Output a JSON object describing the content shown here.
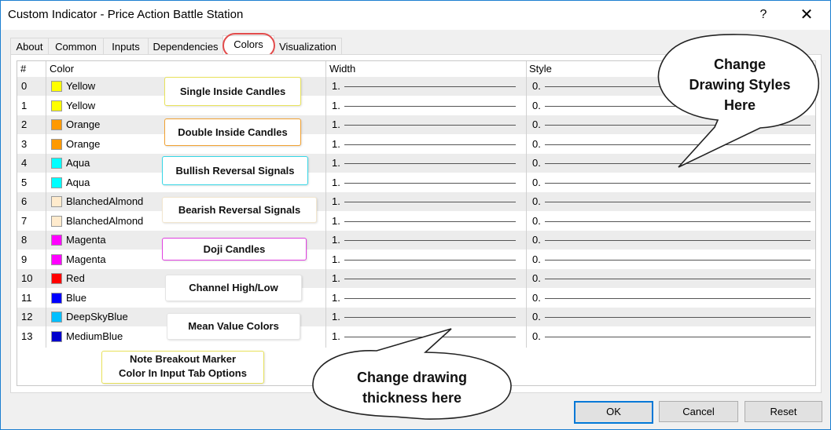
{
  "window": {
    "title": "Custom Indicator - Price Action Battle Station",
    "help_glyph": "?",
    "close_glyph": "✕"
  },
  "tabs": [
    {
      "label": "About",
      "active": false
    },
    {
      "label": "Common",
      "active": false
    },
    {
      "label": "Inputs",
      "active": false
    },
    {
      "label": "Dependencies",
      "active": false
    },
    {
      "label": "Colors",
      "active": true
    },
    {
      "label": "Visualization",
      "active": false
    }
  ],
  "table": {
    "headers": {
      "num": "#",
      "color": "Color",
      "width": "Width",
      "style": "Style"
    },
    "rows": [
      {
        "num": "0",
        "color": "Yellow",
        "hex": "#ffff00",
        "width": "1.",
        "style": "0."
      },
      {
        "num": "1",
        "color": "Yellow",
        "hex": "#ffff00",
        "width": "1.",
        "style": "0."
      },
      {
        "num": "2",
        "color": "Orange",
        "hex": "#ff9900",
        "width": "1.",
        "style": "0."
      },
      {
        "num": "3",
        "color": "Orange",
        "hex": "#ff9900",
        "width": "1.",
        "style": "0."
      },
      {
        "num": "4",
        "color": "Aqua",
        "hex": "#00ffff",
        "width": "1.",
        "style": "0."
      },
      {
        "num": "5",
        "color": "Aqua",
        "hex": "#00ffff",
        "width": "1.",
        "style": "0."
      },
      {
        "num": "6",
        "color": "BlanchedAlmond",
        "hex": "#ffebcd",
        "width": "1.",
        "style": "0."
      },
      {
        "num": "7",
        "color": "BlanchedAlmond",
        "hex": "#ffebcd",
        "width": "1.",
        "style": "0."
      },
      {
        "num": "8",
        "color": "Magenta",
        "hex": "#ff00ff",
        "width": "1.",
        "style": "0."
      },
      {
        "num": "9",
        "color": "Magenta",
        "hex": "#ff00ff",
        "width": "1.",
        "style": "0."
      },
      {
        "num": "10",
        "color": "Red",
        "hex": "#ff0000",
        "width": "1.",
        "style": "0."
      },
      {
        "num": "11",
        "color": "Blue",
        "hex": "#0000ff",
        "width": "1.",
        "style": "0."
      },
      {
        "num": "12",
        "color": "DeepSkyBlue",
        "hex": "#00bfff",
        "width": "1.",
        "style": "0."
      },
      {
        "num": "13",
        "color": "MediumBlue",
        "hex": "#0000cd",
        "width": "1.",
        "style": "0."
      }
    ]
  },
  "annotations": {
    "single_inside": {
      "text": "Single Inside Candles",
      "border": "#e8e25a"
    },
    "double_inside": {
      "text": "Double Inside Candles",
      "border": "#f0a030"
    },
    "bullish": {
      "text": "Bullish Reversal Signals",
      "border": "#35d6e6"
    },
    "bearish": {
      "text": "Bearish Reversal Signals",
      "border": "#f2e6cf"
    },
    "doji": {
      "text": "Doji Candles",
      "border": "#e040e0"
    },
    "channel": {
      "text": "Channel High/Low",
      "border": "#e4e4e4"
    },
    "mean_value": {
      "text": "Mean Value Colors",
      "border": "#e4e4e4"
    },
    "note_line1": "Note Breakout Marker",
    "note_line2": "Color In Input Tab Options",
    "note_border": "#e8e25a"
  },
  "bubbles": {
    "styles_line1": "Change",
    "styles_line2": "Drawing Styles",
    "styles_line3": "Here",
    "thickness_line1": "Change drawing",
    "thickness_line2": "thickness here"
  },
  "buttons": {
    "ok": "OK",
    "cancel": "Cancel",
    "reset": "Reset"
  }
}
